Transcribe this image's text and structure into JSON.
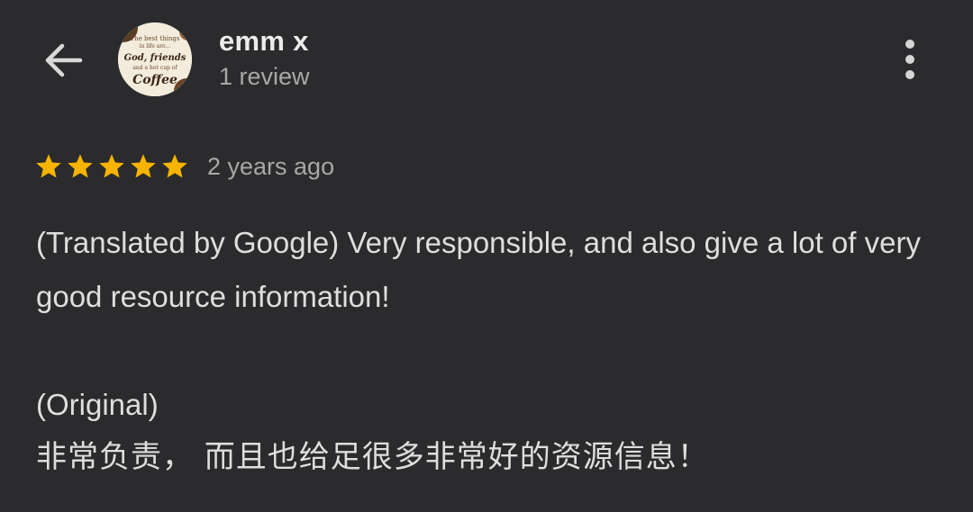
{
  "header": {
    "back_icon": "arrow-left-icon",
    "user_name": "emm x",
    "review_count": "1 review",
    "avatar": {
      "text_line1": "The best things",
      "text_line2": "in life are...",
      "text_line3": "God, friends",
      "text_line4": "and a hot cup of",
      "text_line5": "Coffee"
    },
    "more_icon": "more-vert-icon"
  },
  "review": {
    "rating": 5,
    "rating_max": 5,
    "star_color": "#f6b400",
    "time_ago": "2 years ago",
    "translated_text": "(Translated by Google) Very responsible, and also give a lot of very good resource information!",
    "original_label": "(Original)",
    "original_text": "非常负责， 而且也给足很多非常好的资源信息！"
  }
}
